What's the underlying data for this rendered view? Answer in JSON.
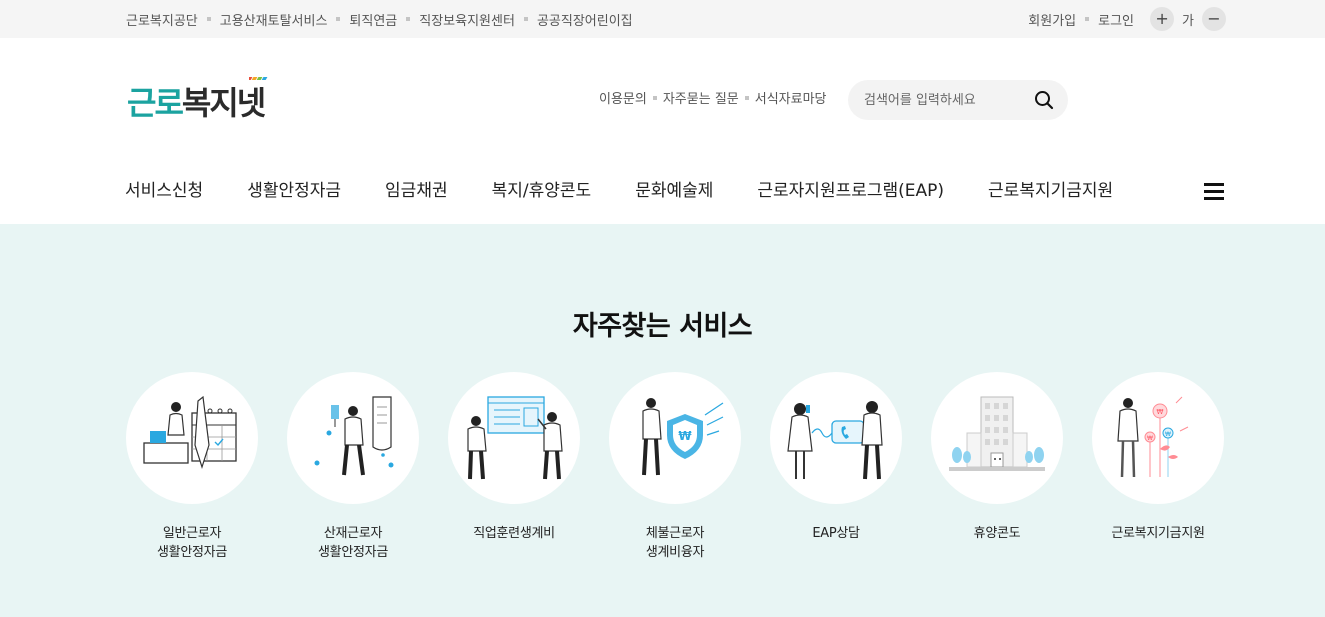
{
  "util": {
    "links": [
      "근로복지공단",
      "고용산재토탈서비스",
      "퇴직연금",
      "직장보육지원센터",
      "공공직장어린이집"
    ],
    "join": "회원가입",
    "login": "로그인",
    "font_plus": "+",
    "font_label": "가",
    "font_minus": "−"
  },
  "logo": {
    "part1": "근로",
    "part2": "복지넷"
  },
  "header_links": [
    "이용문의",
    "자주묻는 질문",
    "서식자료마당"
  ],
  "search": {
    "placeholder": "검색어를 입력하세요",
    "value": ""
  },
  "gnb": [
    "서비스신청",
    "생활안정자금",
    "임금채권",
    "복지/휴양콘도",
    "문화예술제",
    "근로자지원프로그램(EAP)",
    "근로복지기금지원"
  ],
  "main": {
    "title": "자주찾는 서비스",
    "services": [
      {
        "label": "일반근로자\n생활안정자금",
        "icon": "calendar-person-icon"
      },
      {
        "label": "산재근로자\n생활안정자금",
        "icon": "injury-person-icon"
      },
      {
        "label": "직업훈련생계비",
        "icon": "training-board-icon"
      },
      {
        "label": "체불근로자\n생계비융자",
        "icon": "shield-won-icon"
      },
      {
        "label": "EAP상담",
        "icon": "phone-consult-icon"
      },
      {
        "label": "휴양콘도",
        "icon": "building-icon"
      },
      {
        "label": "근로복지기금지원",
        "icon": "money-flower-icon"
      }
    ]
  },
  "colors": {
    "accent": "#1ba3a0",
    "main_bg": "#e8f5f4",
    "icon_blue": "#2aa8e0"
  }
}
